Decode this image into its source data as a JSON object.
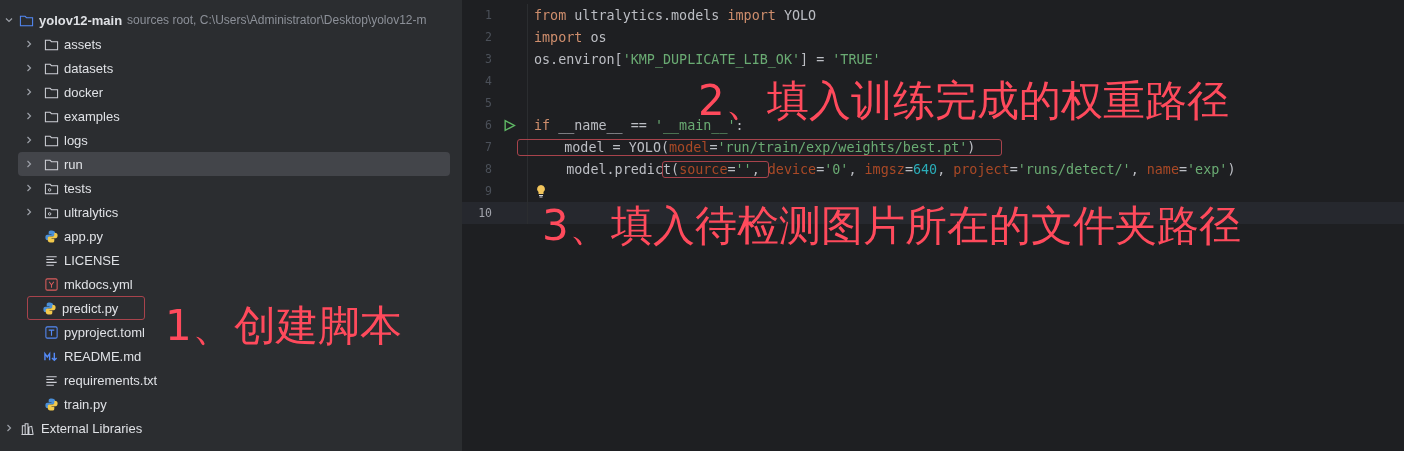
{
  "project": {
    "name": "yolov12-main",
    "hint": "sources root,  C:\\Users\\Administrator\\Desktop\\yolov12-m",
    "expanded": true,
    "children": [
      {
        "name": "assets",
        "kind": "folder",
        "selected": false
      },
      {
        "name": "datasets",
        "kind": "folder",
        "selected": false
      },
      {
        "name": "docker",
        "kind": "folder",
        "selected": false
      },
      {
        "name": "examples",
        "kind": "folder",
        "selected": false
      },
      {
        "name": "logs",
        "kind": "folder",
        "selected": false
      },
      {
        "name": "run",
        "kind": "folder",
        "selected": true
      },
      {
        "name": "tests",
        "kind": "package",
        "selected": false
      },
      {
        "name": "ultralytics",
        "kind": "package",
        "selected": false
      },
      {
        "name": "app.py",
        "kind": "python",
        "selected": false
      },
      {
        "name": "LICENSE",
        "kind": "text",
        "selected": false
      },
      {
        "name": "mkdocs.yml",
        "kind": "yaml",
        "selected": false
      },
      {
        "name": "predict.py",
        "kind": "python",
        "selected": false,
        "marked": true
      },
      {
        "name": "pyproject.toml",
        "kind": "toml",
        "selected": false
      },
      {
        "name": "README.md",
        "kind": "markdown",
        "selected": false
      },
      {
        "name": "requirements.txt",
        "kind": "text",
        "selected": false
      },
      {
        "name": "train.py",
        "kind": "python",
        "selected": false
      }
    ]
  },
  "external_libraries": {
    "name": "External Libraries",
    "expanded": false
  },
  "editor": {
    "lines": [
      {
        "number": "1",
        "tokens": [
          {
            "text": "from",
            "kind": "keyword"
          },
          {
            "text": " ultralytics.models ",
            "kind": "plain"
          },
          {
            "text": "import",
            "kind": "keyword"
          },
          {
            "text": " YOLO",
            "kind": "plain"
          }
        ]
      },
      {
        "number": "2",
        "tokens": [
          {
            "text": "import",
            "kind": "keyword"
          },
          {
            "text": " os",
            "kind": "plain"
          }
        ]
      },
      {
        "number": "3",
        "tokens": [
          {
            "text": "os.environ[",
            "kind": "plain"
          },
          {
            "text": "'KMP_DUPLICATE_LIB_OK'",
            "kind": "string"
          },
          {
            "text": "] = ",
            "kind": "plain"
          },
          {
            "text": "'TRUE'",
            "kind": "string"
          }
        ]
      },
      {
        "number": "4"
      },
      {
        "number": "5"
      },
      {
        "number": "6",
        "run": true,
        "tokens": [
          {
            "text": "if",
            "kind": "keyword"
          },
          {
            "text": " __name__ == ",
            "kind": "plain"
          },
          {
            "text": "'__main__'",
            "kind": "string"
          },
          {
            "text": ":",
            "kind": "plain"
          }
        ]
      },
      {
        "number": "7",
        "boxed": true,
        "tokens": [
          {
            "text": "    model = YOLO(",
            "kind": "plain"
          },
          {
            "text": "model",
            "kind": "param"
          },
          {
            "text": "=",
            "kind": "plain"
          },
          {
            "text": "'run/train/exp/weights/best.pt'",
            "kind": "string"
          },
          {
            "text": ")",
            "kind": "plain"
          }
        ]
      },
      {
        "number": "8",
        "tokens": [
          {
            "text": "    model.predic",
            "kind": "plain"
          },
          {
            "text": "t(",
            "kind": "plain",
            "boxed": true
          },
          {
            "text": "source",
            "kind": "param",
            "boxed": true
          },
          {
            "text": "=",
            "kind": "plain",
            "boxed": true
          },
          {
            "text": "''",
            "kind": "string",
            "boxed": true
          },
          {
            "text": ", ",
            "kind": "plain",
            "boxed": true
          },
          {
            "text": "device",
            "kind": "param"
          },
          {
            "text": "=",
            "kind": "plain"
          },
          {
            "text": "'0'",
            "kind": "string"
          },
          {
            "text": ", ",
            "kind": "plain"
          },
          {
            "text": "imgsz",
            "kind": "param"
          },
          {
            "text": "=",
            "kind": "plain"
          },
          {
            "text": "640",
            "kind": "number"
          },
          {
            "text": ", ",
            "kind": "plain"
          },
          {
            "text": "project",
            "kind": "param"
          },
          {
            "text": "=",
            "kind": "plain"
          },
          {
            "text": "'runs/detect/'",
            "kind": "string"
          },
          {
            "text": ", ",
            "kind": "plain"
          },
          {
            "text": "name",
            "kind": "param"
          },
          {
            "text": "=",
            "kind": "plain"
          },
          {
            "text": "'exp'",
            "kind": "string"
          },
          {
            "text": ")",
            "kind": "plain"
          }
        ]
      },
      {
        "number": "9",
        "bulb": true
      },
      {
        "number": "10",
        "current": true
      }
    ]
  },
  "annotations": [
    "1、创建脚本",
    "2、填入训练完成的权重路径",
    "3、填入待检测图片所在的文件夹路径"
  ]
}
